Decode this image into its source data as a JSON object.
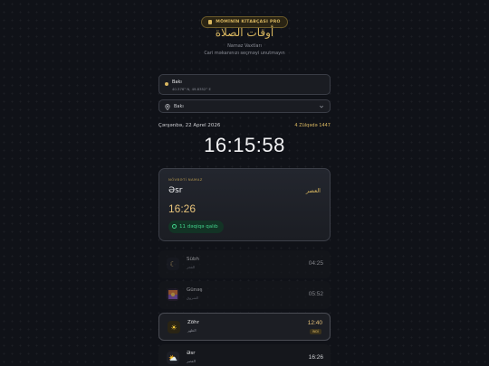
{
  "header": {
    "badge": "MÖMİNİN KİTABÇASI PRO",
    "arabic_title": "أوقات الصلاة",
    "subtitle": "Namaz Vaxtları",
    "hint": "Cari məkanınızı seçməyi unutmayın"
  },
  "location": {
    "city": "Bakı",
    "coords": "40.376° N, 49.8352° E"
  },
  "city_select": {
    "value": "Bakı"
  },
  "date": {
    "gregorian": "Çərşənbə, 22 Aprel 2026",
    "hijri": "4 Zülqədə 1447"
  },
  "clock": "16:15:58",
  "next": {
    "label": "NÖVBƏTİ NAMAZ",
    "name": "Əsr",
    "arabic": "العصر",
    "time": "16:26",
    "remaining": "11 dəqiqə qalıb"
  },
  "prayers": [
    {
      "name": "Sübh",
      "arabic": "الفجر",
      "time": "04:25",
      "icon": "moon-icon"
    },
    {
      "name": "Günəş",
      "arabic": "الشروق",
      "time": "05:52",
      "icon": "sunrise-icon"
    },
    {
      "name": "Zöhr",
      "arabic": "الظهر",
      "time": "12:40",
      "icon": "sun-icon",
      "tag": "İNDİ"
    },
    {
      "name": "Əsr",
      "arabic": "العصر",
      "time": "16:26",
      "icon": "cloud-sun-icon"
    }
  ],
  "colors": {
    "accent_gold": "#d9b760",
    "remaining_green": "#41d18a",
    "background": "#101218"
  }
}
